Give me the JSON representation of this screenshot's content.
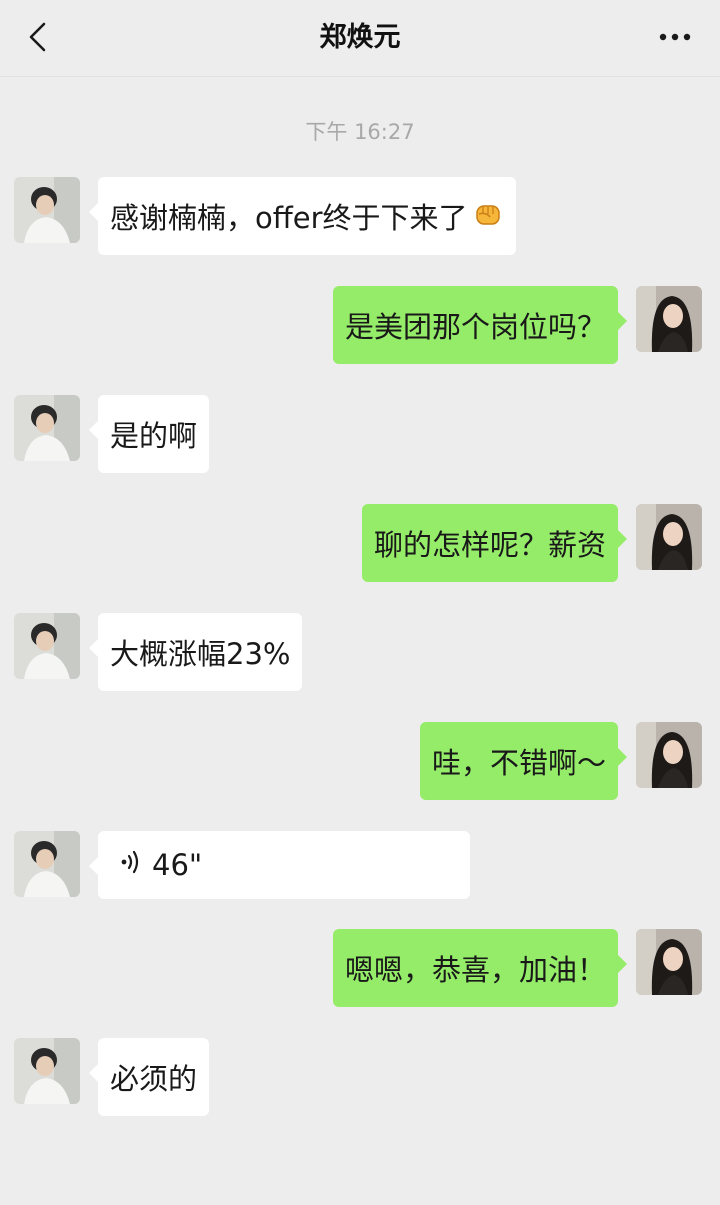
{
  "header": {
    "title": "郑焕元",
    "back_icon": "chevron-left-icon",
    "more_icon": "more-dots-icon"
  },
  "chat": {
    "timestamp": "下午 16:27",
    "messages": [
      {
        "side": "in",
        "type": "text",
        "text": "感谢楠楠，offer终于下来了",
        "emoji": "fist-emoji-icon"
      },
      {
        "side": "out",
        "type": "text",
        "text": "是美团那个岗位吗？"
      },
      {
        "side": "in",
        "type": "text",
        "text": "是的啊"
      },
      {
        "side": "out",
        "type": "text",
        "text": "聊的怎样呢？薪资"
      },
      {
        "side": "in",
        "type": "text",
        "text": "大概涨幅23%"
      },
      {
        "side": "out",
        "type": "text",
        "text": "哇，不错啊～"
      },
      {
        "side": "in",
        "type": "voice",
        "duration": "46\"",
        "icon": "voice-wave-icon"
      },
      {
        "side": "out",
        "type": "text",
        "text": "嗯嗯，恭喜，加油！"
      },
      {
        "side": "in",
        "type": "text",
        "text": "必须的"
      }
    ]
  },
  "colors": {
    "background": "#ededed",
    "incoming_bubble": "#ffffff",
    "outgoing_bubble": "#95ec69",
    "timestamp_text": "#a8a8a8"
  }
}
